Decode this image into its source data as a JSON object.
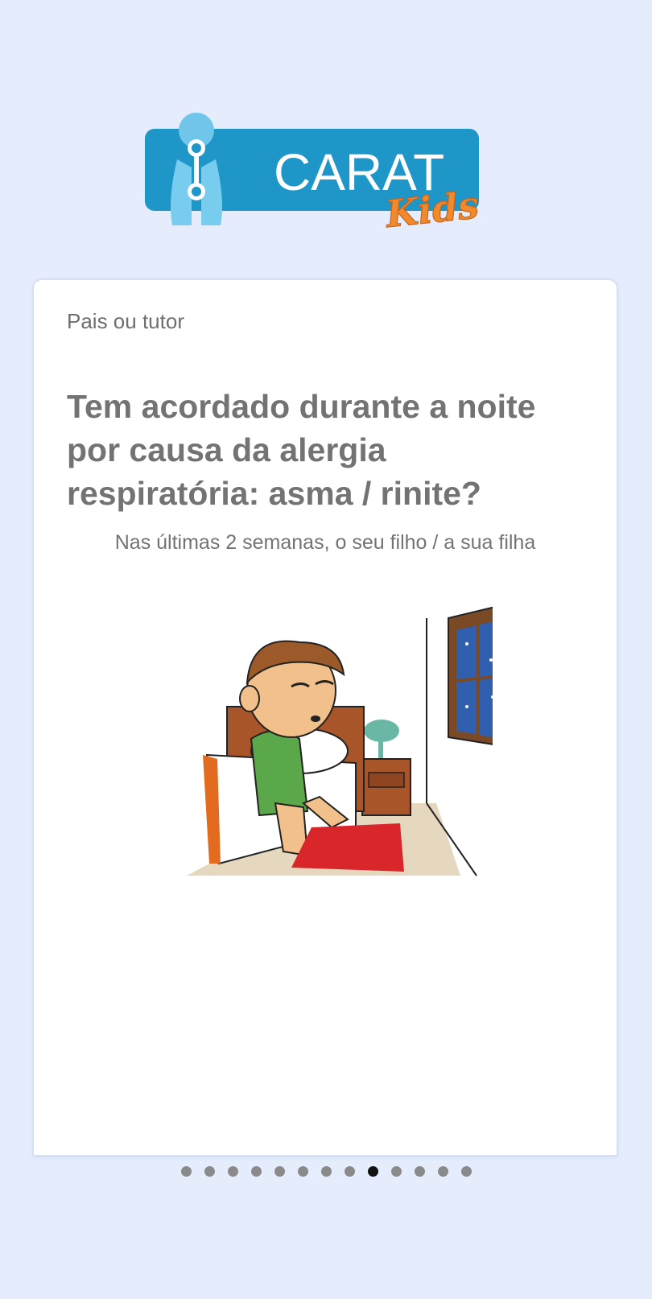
{
  "app": {
    "logo_text": "CARAT",
    "logo_subtext": "Kids",
    "brand_color": "#1e96c8",
    "accent_color": "#f08a2c"
  },
  "card": {
    "respondent": "Pais ou tutor",
    "question": "Tem acordado durante a noite por causa da alergia respiratória: asma / rinite?",
    "subtitle": "Nas últimas 2 semanas, o seu filho / a sua filha",
    "illustration": "boy-awake-in-bed-at-night"
  },
  "pager": {
    "total_pages": 13,
    "current_page": 9
  }
}
